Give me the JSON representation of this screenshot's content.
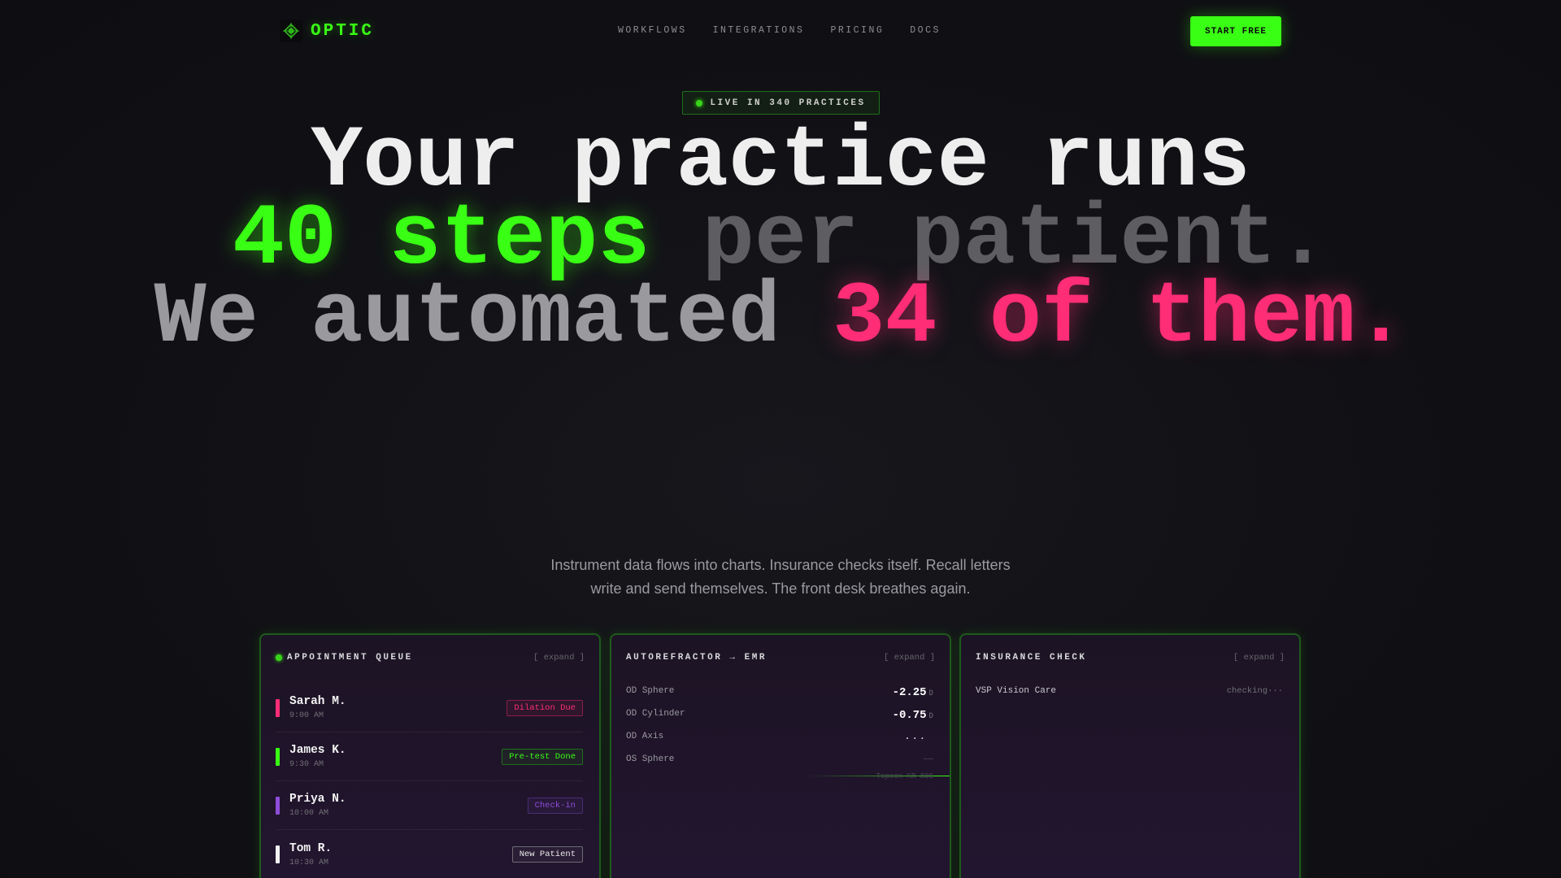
{
  "nav": {
    "brand": "OPTIC",
    "links": [
      "WORKFLOWS",
      "INTEGRATIONS",
      "PRICING",
      "DOCS"
    ],
    "cta": "START FREE"
  },
  "badge": {
    "text": "LIVE IN 340 PRACTICES"
  },
  "hero": {
    "line1": "Your practice runs",
    "highlight_green": "40 steps",
    "rest_gray": " per patient.",
    "line3_light": "We automated ",
    "highlight_pink": "34 of them."
  },
  "subtitle": "Instrument data flows into charts. Insurance checks itself. Recall letters write and send themselves. The front desk breathes again.",
  "panels": {
    "queue": {
      "title": "APPOINTMENT QUEUE",
      "expand": "[ expand ]",
      "rows": [
        {
          "name": "Sarah M.",
          "time": "9:00 AM",
          "tag": "Dilation Due",
          "color": "#ff2d75"
        },
        {
          "name": "James K.",
          "time": "9:30 AM",
          "tag": "Pre-test Done",
          "color": "#39ff14"
        },
        {
          "name": "Priya N.",
          "time": "10:00 AM",
          "tag": "Check-in",
          "color": "#8e4dd8"
        },
        {
          "name": "Tom R.",
          "time": "10:30 AM",
          "tag": "New Patient",
          "color": "#f2f2f2"
        }
      ]
    },
    "autorefractor": {
      "title": "AUTOREFRACTOR → EMR",
      "expand": "[ expand ]",
      "rows": [
        {
          "label": "OD Sphere",
          "value": "-2.25",
          "unit": "D"
        },
        {
          "label": "OD Cylinder",
          "value": "-0.75",
          "unit": "D"
        },
        {
          "label": "OD Axis",
          "value": "..."
        },
        {
          "label": "OS Sphere",
          "value": "——"
        }
      ],
      "source": "Topcon KR-800"
    },
    "insurance": {
      "title": "INSURANCE CHECK",
      "expand": "[ expand ]",
      "carrier": "VSP Vision Care",
      "status": "checking···"
    }
  },
  "colors": {
    "accent_green": "#39ff14",
    "accent_pink": "#ff2d75",
    "accent_purple": "#8e4dd8"
  },
  "icons": {
    "brand": "eye-crosshair-icon",
    "status_dot": "live-dot-icon"
  }
}
